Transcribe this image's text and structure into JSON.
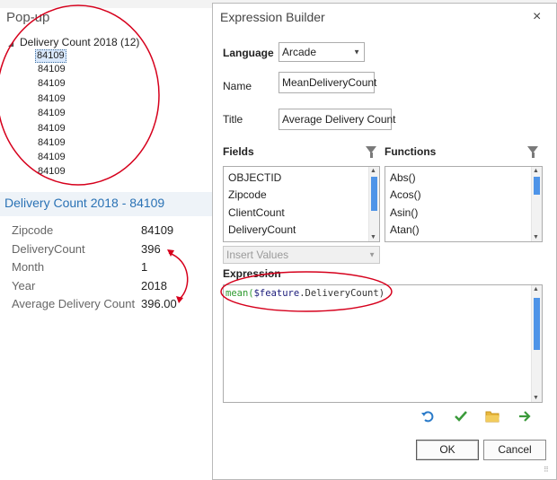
{
  "popup": {
    "title": "Pop-up",
    "tree": {
      "toggle": "◢",
      "header": "Delivery Count 2018  (12)",
      "items": [
        "84109",
        "84109",
        "84109",
        "84109",
        "84109",
        "84109",
        "84109",
        "84109",
        "84109"
      ]
    },
    "record_title": "Delivery Count 2018 - 84109",
    "attributes": [
      {
        "name": "Zipcode",
        "value": "84109"
      },
      {
        "name": "DeliveryCount",
        "value": "396"
      },
      {
        "name": "Month",
        "value": "1"
      },
      {
        "name": "Year",
        "value": "2018"
      },
      {
        "name": "Average Delivery Count",
        "value": "396.00"
      }
    ]
  },
  "dialog": {
    "title": "Expression Builder",
    "close": "×",
    "language_label": "Language",
    "language_value": "Arcade",
    "name_label": "Name",
    "name_value": "MeanDeliveryCount",
    "title_label": "Title",
    "title_value": "Average Delivery Count",
    "fields_label": "Fields",
    "functions_label": "Functions",
    "fields": [
      "OBJECTID",
      "Zipcode",
      "ClientCount",
      "DeliveryCount"
    ],
    "functions": [
      "Abs()",
      "Acos()",
      "Asin()",
      "Atan()"
    ],
    "insert_values": "Insert Values",
    "expression_label": "Expression",
    "expression": {
      "fn": "mean(",
      "var": "$feature",
      "prop": ".DeliveryCount)"
    },
    "ok_label": "OK",
    "cancel_label": "Cancel"
  },
  "colors": {
    "annotation": "#d6001c",
    "accent": "#2a72b5",
    "scroll_thumb": "#4e94e8"
  },
  "icons": [
    "funnel-icon",
    "undo-icon",
    "check-icon",
    "folder-icon",
    "arrow-right-icon",
    "close-icon",
    "dropdown-arrow-icon",
    "resize-grip-icon"
  ]
}
